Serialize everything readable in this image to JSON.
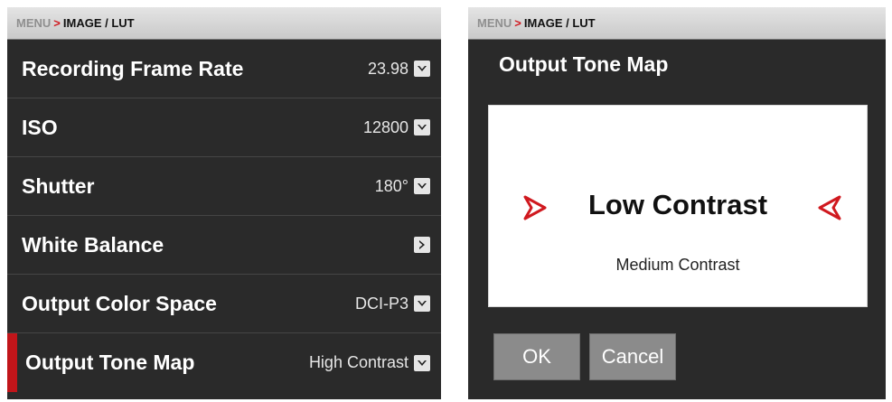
{
  "left": {
    "breadcrumb": {
      "menu": "MENU",
      "separator": ">",
      "path": "IMAGE / LUT"
    },
    "rows": [
      {
        "label": "Recording Frame Rate",
        "value": "23.98"
      },
      {
        "label": "ISO",
        "value": "12800"
      },
      {
        "label": "Shutter",
        "value": "180°"
      },
      {
        "label": "White Balance",
        "value": ""
      },
      {
        "label": "Output Color Space",
        "value": "DCI-P3"
      },
      {
        "label": "Output Tone Map",
        "value": "High Contrast"
      }
    ],
    "selection_color": "#c1151a"
  },
  "right": {
    "breadcrumb": {
      "menu": "MENU",
      "separator": ">",
      "path": "IMAGE / LUT"
    },
    "dialog_title": "Output Tone Map",
    "picker": {
      "selected": "Low Contrast",
      "next": "Medium Contrast"
    },
    "buttons": {
      "ok": "OK",
      "cancel": "Cancel"
    },
    "accent_color": "#d0191f"
  }
}
